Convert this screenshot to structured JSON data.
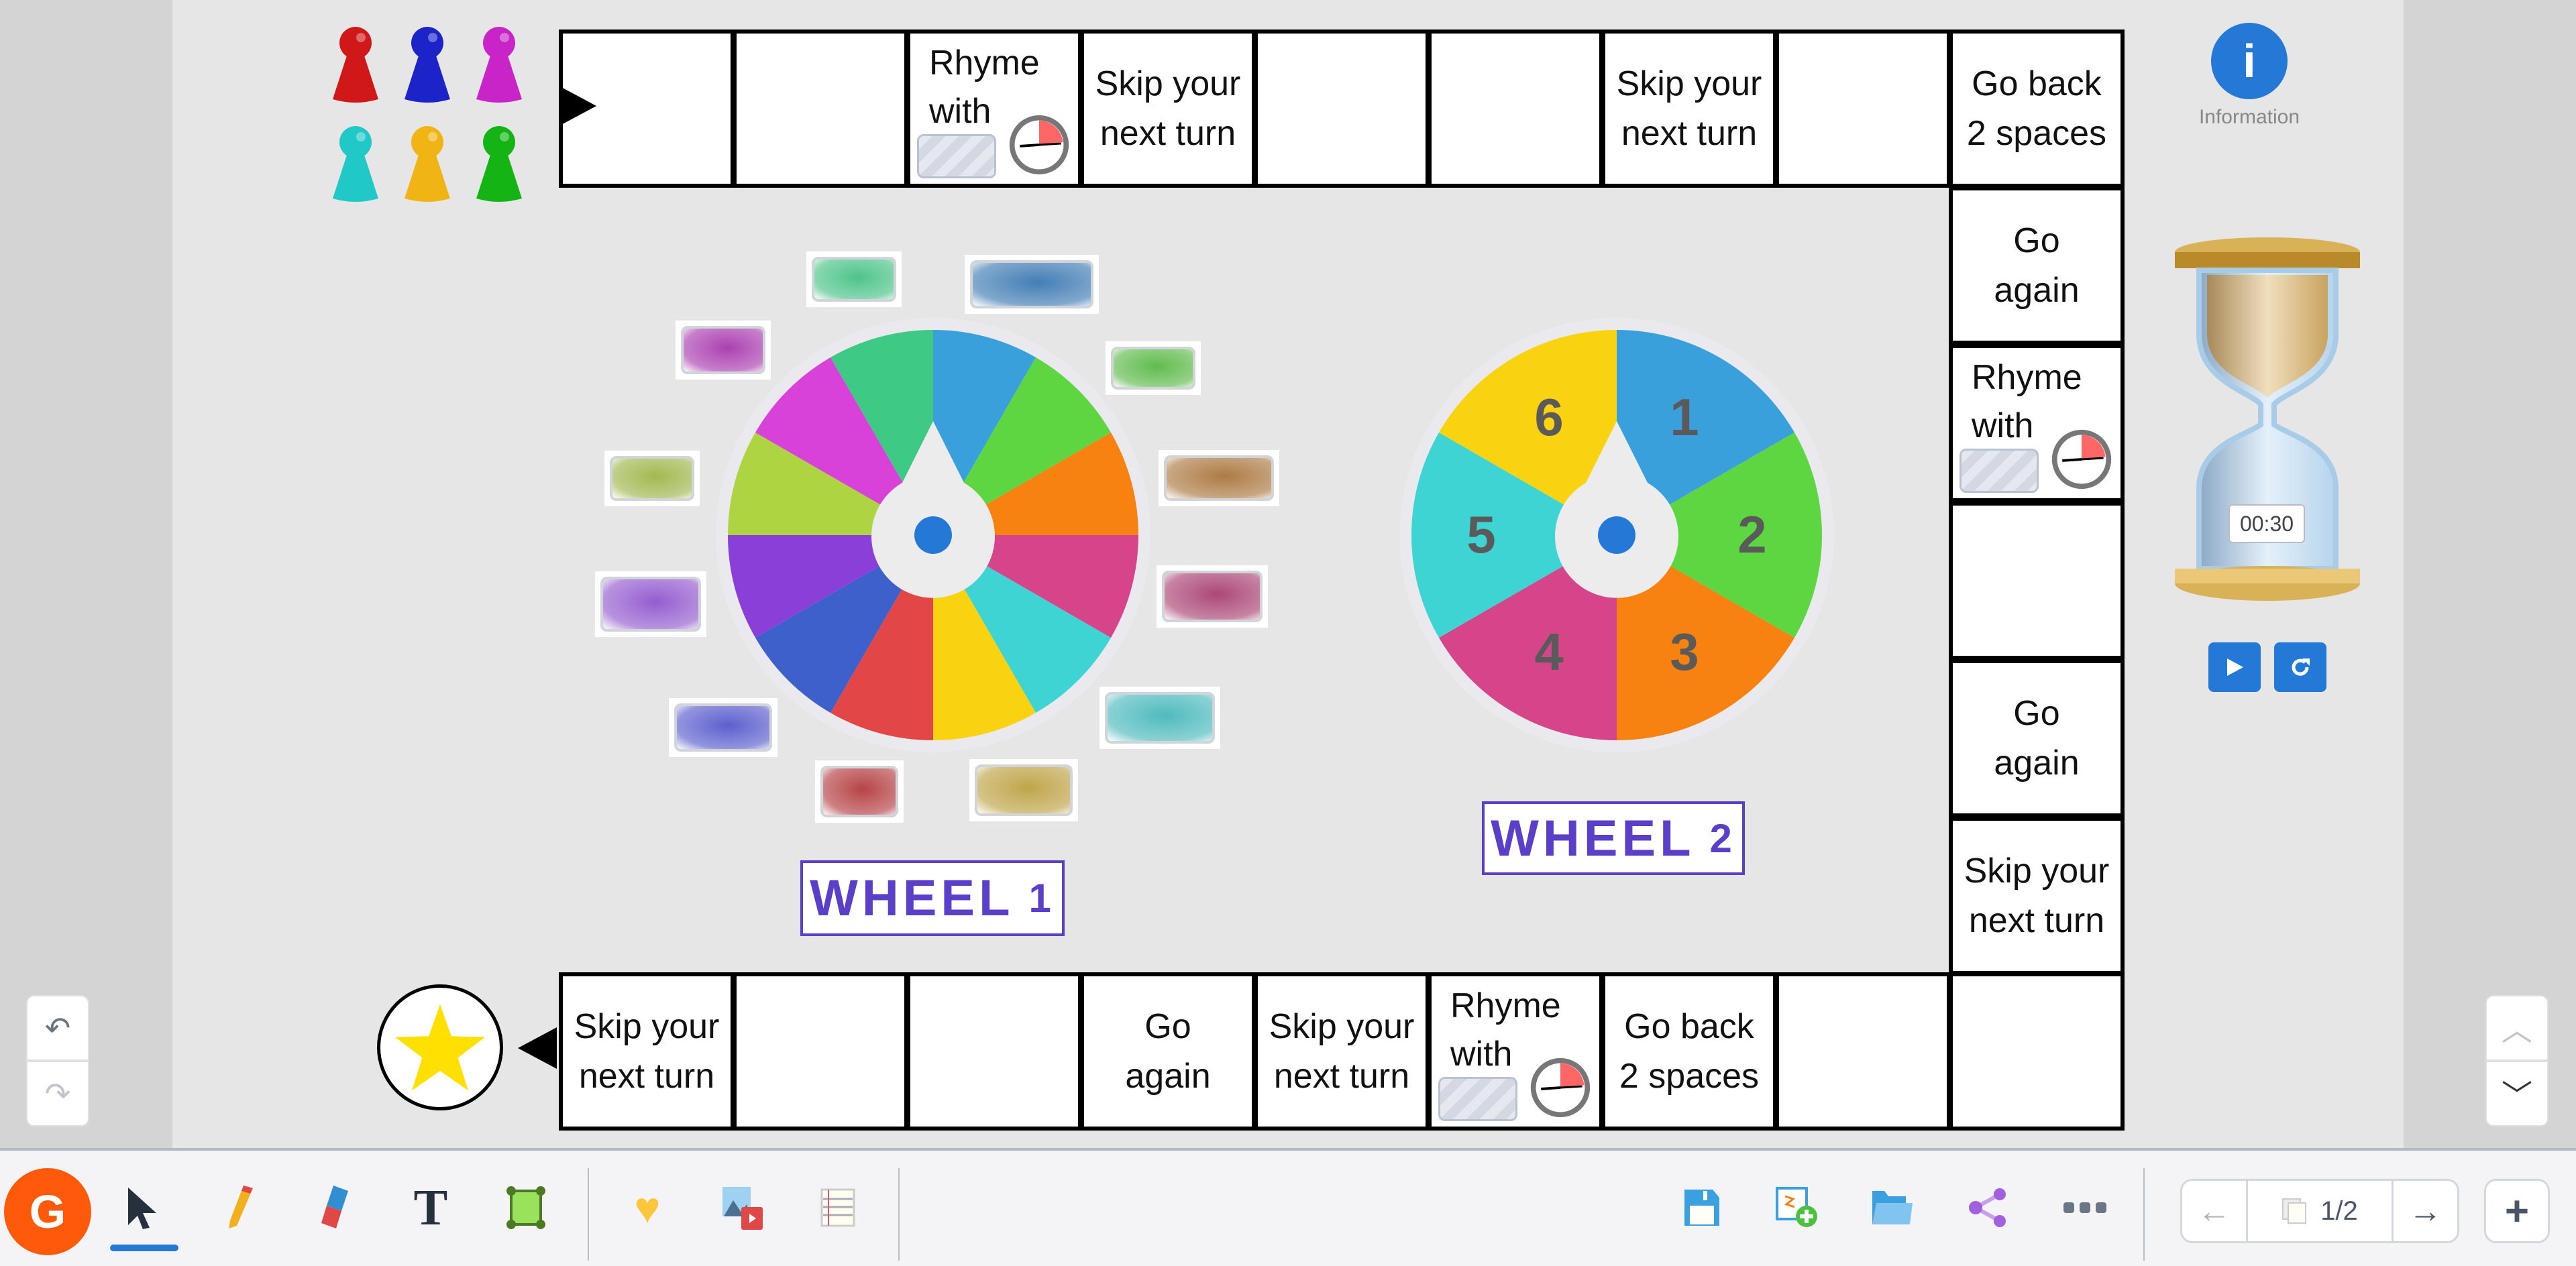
{
  "board": {
    "top_row": [
      "",
      "",
      "Rhyme\nwith",
      "Skip your\nnext turn",
      "",
      "",
      "Skip your\nnext turn",
      "",
      "Go back\n2 spaces"
    ],
    "right_column": [
      "Go\nagain",
      "Rhyme\nwith",
      "",
      "Go\nagain",
      "Skip your\nnext turn"
    ],
    "bottom_row": [
      "Skip your\nnext turn",
      "",
      "",
      "Go\nagain",
      "Skip your\nnext turn",
      "Rhyme\nwith",
      "Go back\n2 spaces",
      "",
      ""
    ],
    "start_icon": "arrow-right-icon",
    "finish_icon": "star-icon"
  },
  "pawns": [
    "#d01818",
    "#1c23c8",
    "#c824c8",
    "#20c8c8",
    "#f0b414",
    "#14b414"
  ],
  "wheel1": {
    "label": "WHEEL",
    "number": "1",
    "segments": [
      "#3aa0db",
      "#5dd641",
      "#f8820f",
      "#d6448a",
      "#3fd4d4",
      "#f9d30f",
      "#e34646",
      "#3d60cb",
      "#8a40d8",
      "#aed442",
      "#d842d8",
      "#3ec985"
    ],
    "cards": [
      "#3ec985",
      "#3a7fc0",
      "#56c040",
      "#b57a3a",
      "#b9437a",
      "#40bfc2",
      "#c4a53a",
      "#c63f43",
      "#5c5ee0",
      "#9b5ae0",
      "#a0bb40",
      "#b93bc0"
    ]
  },
  "wheel2": {
    "label": "WHEEL",
    "number": "2",
    "segments": [
      {
        "n": "1",
        "color": "#3aa0db"
      },
      {
        "n": "2",
        "color": "#5dd641"
      },
      {
        "n": "3",
        "color": "#f8820f"
      },
      {
        "n": "4",
        "color": "#d6448a"
      },
      {
        "n": "5",
        "color": "#3fd4d4"
      },
      {
        "n": "6",
        "color": "#f9d30f"
      }
    ]
  },
  "info": {
    "label": "Information"
  },
  "timer": {
    "value": "00:30"
  },
  "toolbar": {
    "page": "1/2",
    "logo": "G",
    "left_tools": [
      "select-icon",
      "pencil-icon",
      "eraser-icon",
      "text-icon",
      "shape-icon",
      "stickers-icon",
      "media-icon",
      "notebook-icon"
    ],
    "right_tools": [
      "save-icon",
      "add-page-icon",
      "folder-icon",
      "share-icon",
      "more-icon"
    ]
  },
  "colors": {
    "accent": "#2479d6",
    "wheel_label": "#5b3fc8",
    "logo": "#ff5a0a"
  }
}
